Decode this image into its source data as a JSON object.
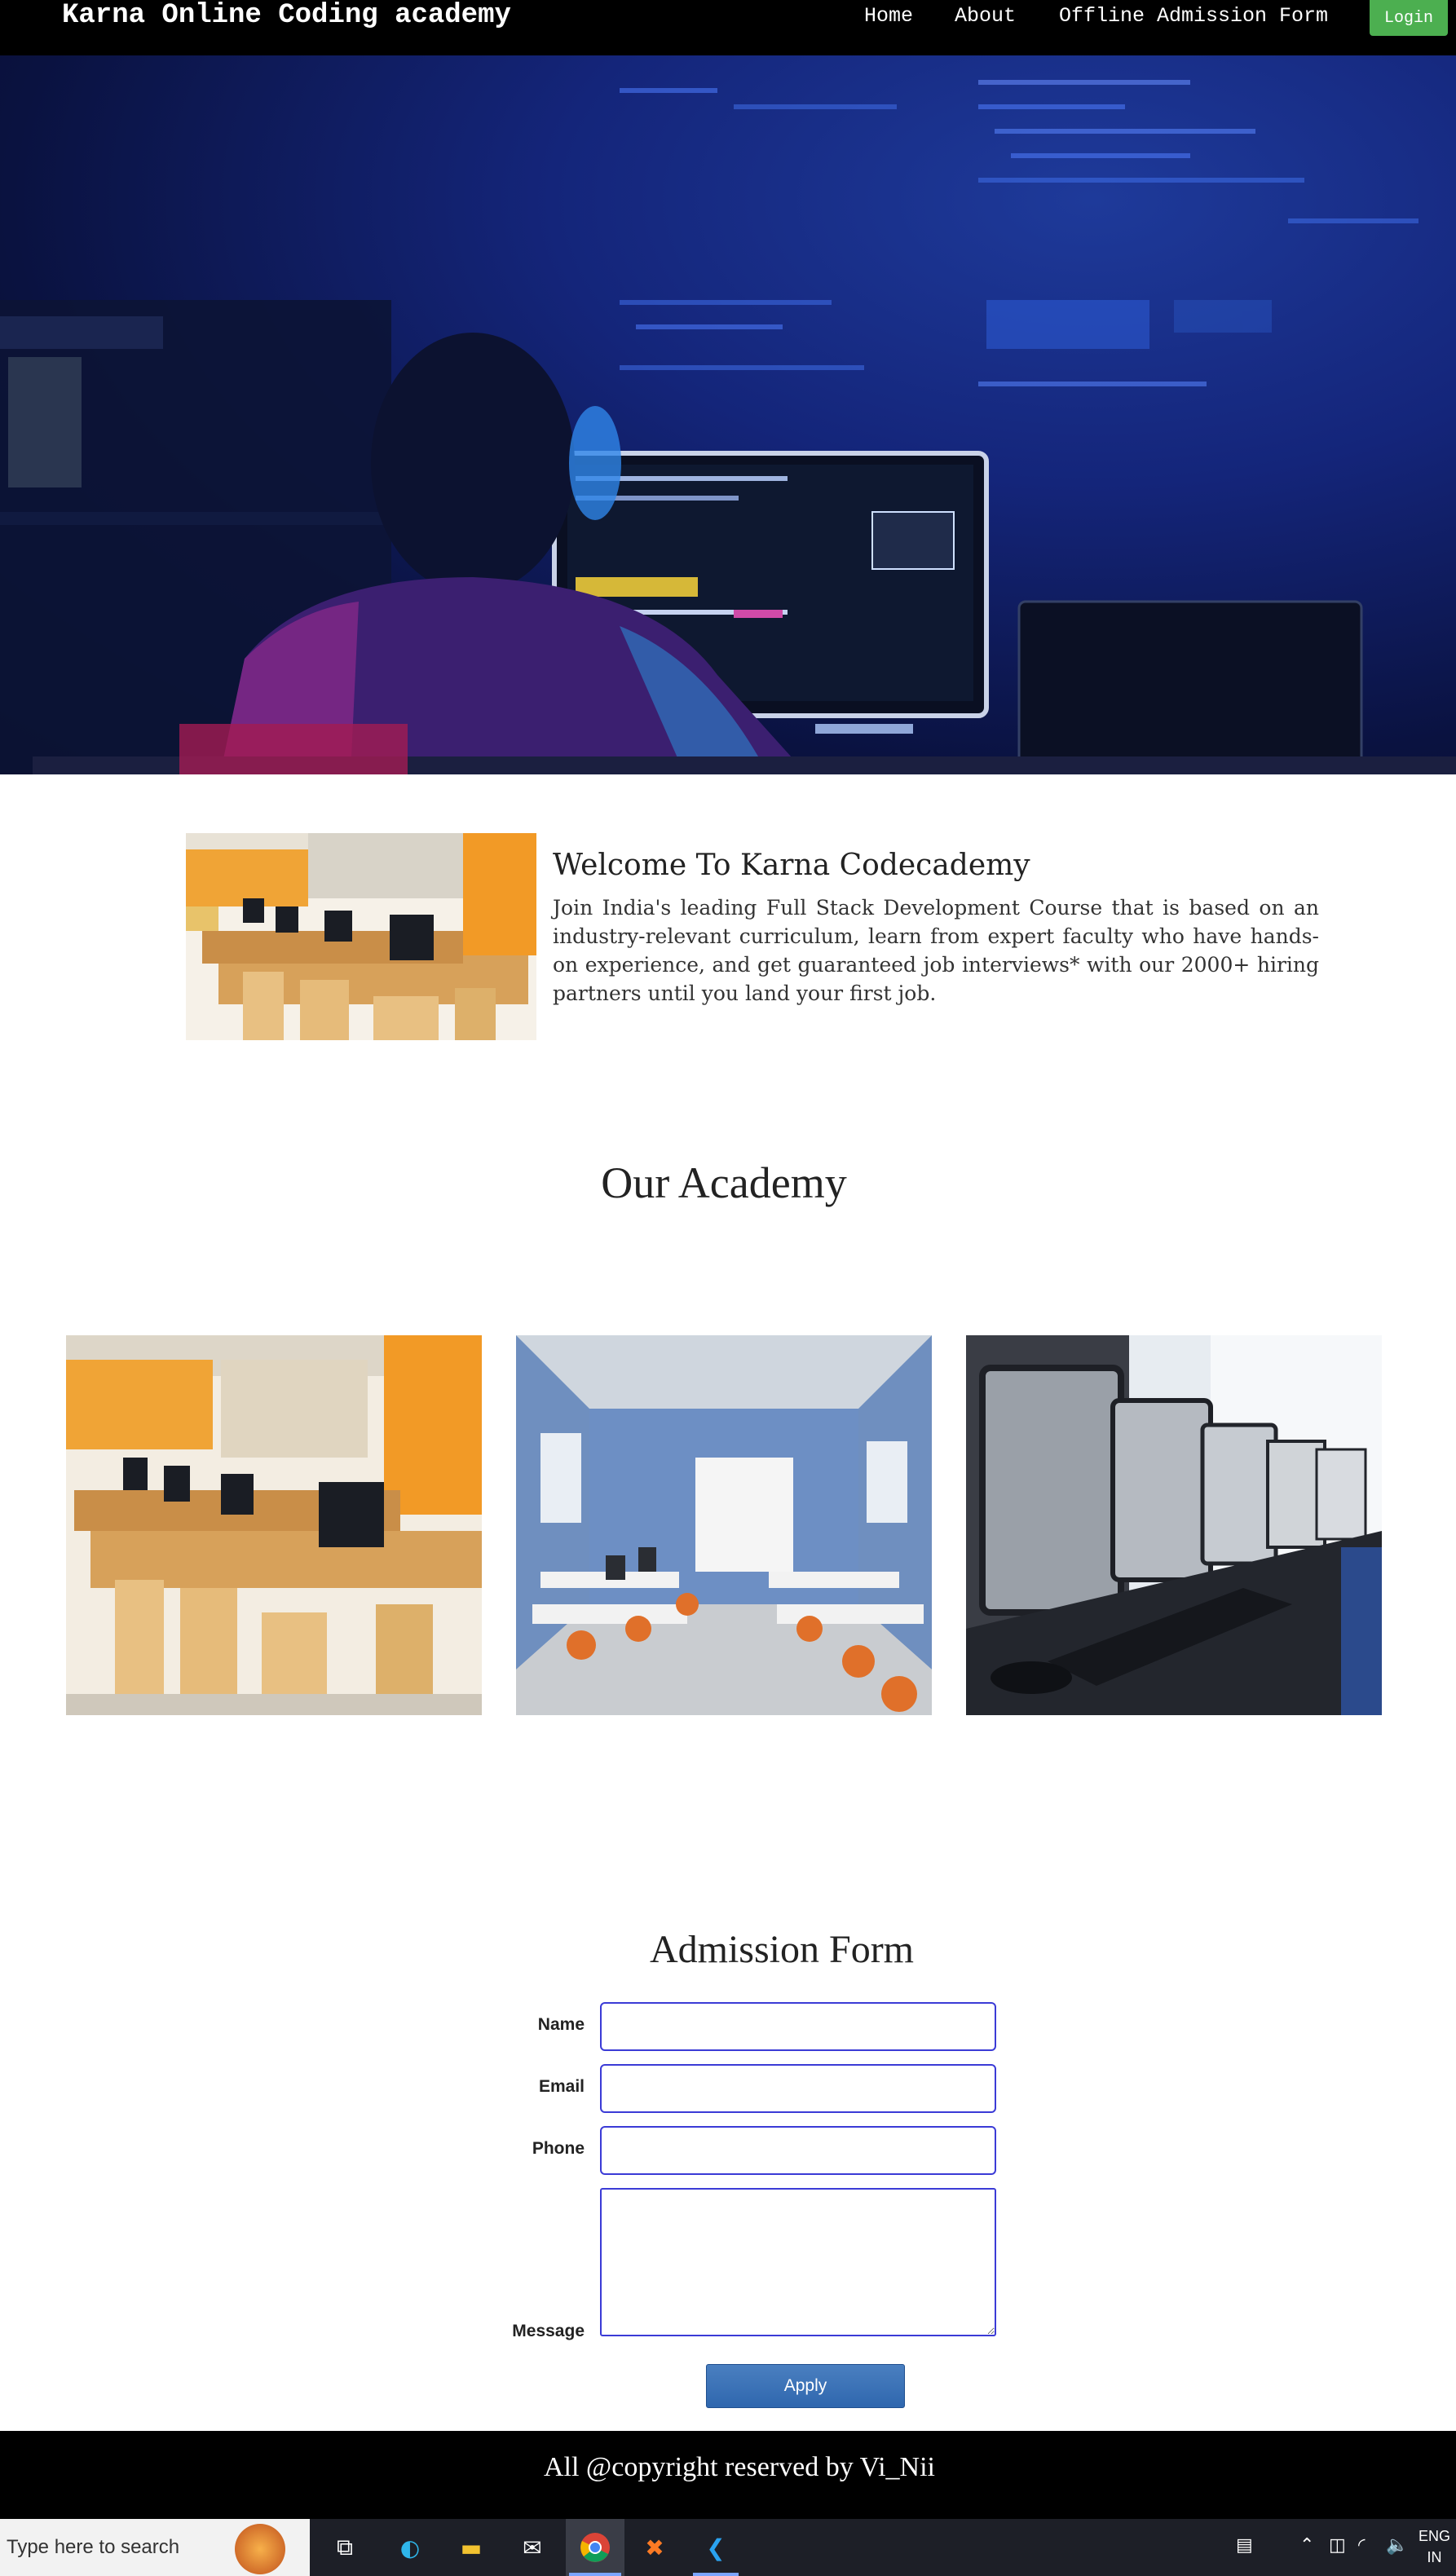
{
  "nav": {
    "brand": "Karna Online Coding academy",
    "links": [
      "Home",
      "About",
      "Offline Admission Form"
    ],
    "login": "Login"
  },
  "welcome": {
    "title": "Welcome To Karna Codecademy",
    "text": "Join India's leading Full Stack Development Course that is based on an industry-relevant curriculum, learn from expert faculty who have hands-on experience, and get guaranteed job interviews* with our 2000+ hiring partners until you land your first job."
  },
  "academy": {
    "title": "Our Academy"
  },
  "form": {
    "title": "Admission Form",
    "fields": [
      {
        "label": "Name",
        "value": ""
      },
      {
        "label": "Email",
        "value": ""
      },
      {
        "label": "Phone",
        "value": ""
      }
    ],
    "message_label": "Message",
    "apply": "Apply"
  },
  "footer": {
    "text": "All @copyright reserved by Vi_Nii"
  },
  "taskbar": {
    "search_placeholder": "Type here to search",
    "lang_line1": "ENG",
    "lang_line2": "IN"
  }
}
